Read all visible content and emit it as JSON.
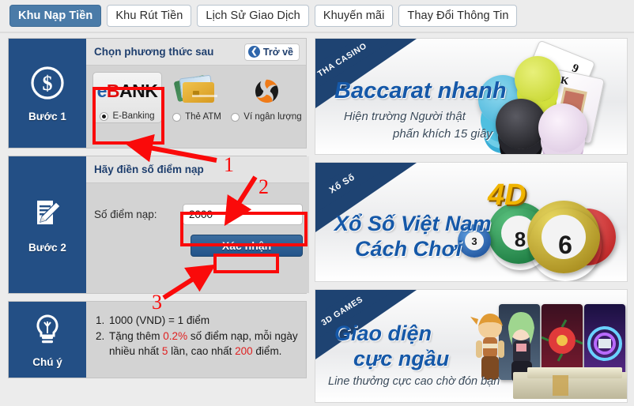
{
  "tabs": [
    {
      "label": "Khu Nạp Tiền",
      "active": true
    },
    {
      "label": "Khu Rút Tiền",
      "active": false
    },
    {
      "label": "Lịch Sử Giao Dịch",
      "active": false
    },
    {
      "label": "Khuyến mãi",
      "active": false
    },
    {
      "label": "Thay Đổi Thông Tin",
      "active": false
    }
  ],
  "step1": {
    "side_label": "Bước 1",
    "icon": "dollar-coin-icon",
    "header_title": "Chọn phương thức sau",
    "back_label": "Trở về",
    "back_icon": "chevron-left-icon",
    "methods": [
      {
        "label": "E-Banking",
        "logo": "ebank-logo",
        "selected": true
      },
      {
        "label": "Thẻ ATM",
        "logo": "atm-cards-icon",
        "selected": false
      },
      {
        "label": "Ví ngân lượng",
        "logo": "nganluong-swirl-icon",
        "selected": false
      }
    ],
    "ebank_logo": {
      "e": "e",
      "b": "B",
      "ank": "ANK"
    }
  },
  "step2": {
    "side_label": "Bước 2",
    "icon": "document-pencil-icon",
    "header_title": "Hãy điền số điểm nạp",
    "field_label": "Số điểm nạp:",
    "amount_value": "2000",
    "amount_placeholder": "",
    "confirm_label": "Xác nhận"
  },
  "note": {
    "side_label": "Chú ý",
    "icon": "lightbulb-icon",
    "items": [
      {
        "num": "1.",
        "parts": [
          {
            "t": "1000 (VND) = 1 điểm",
            "hl": false
          }
        ]
      },
      {
        "num": "2.",
        "parts": [
          {
            "t": "Tặng thêm ",
            "hl": false
          },
          {
            "t": "0.2%",
            "hl": true
          },
          {
            "t": " số điểm nạp, mỗi ngày nhiều nhất ",
            "hl": false
          },
          {
            "t": "5",
            "hl": true
          },
          {
            "t": " lần, cao nhất ",
            "hl": false
          },
          {
            "t": "200",
            "hl": true
          },
          {
            "t": " điểm.",
            "hl": false
          }
        ]
      }
    ]
  },
  "banners": [
    {
      "ribbon": "THA CASINO",
      "title": "Baccarat nhanh",
      "sub1": "Hiện trường Người thật",
      "sub2": "phấn khích 15 giây",
      "art": "casino-chips-cards-art"
    },
    {
      "ribbon": "Xổ Số",
      "title1": "Xổ Số Việt Nam",
      "title2": "Cách Chơi",
      "badge": "4D",
      "ball_numbers": [
        "3",
        "8",
        "6"
      ],
      "art": "lottery-balls-art"
    },
    {
      "ribbon": "3D GAMES",
      "title1": "Giao diện",
      "title2": "cực ngầu",
      "sub": "Line thưởng cực cao chờ đón bạn",
      "art": "3d-game-characters-art"
    }
  ],
  "annotations": {
    "markers": [
      "1",
      "2",
      "3"
    ],
    "color": "#fa0a0a"
  },
  "colors": {
    "brand_navy": "#234f85",
    "tab_active": "#4a7ba8",
    "panel_gray": "#d3d3d3",
    "annotation_red": "#fa0a0a",
    "note_highlight": "#e02020"
  }
}
